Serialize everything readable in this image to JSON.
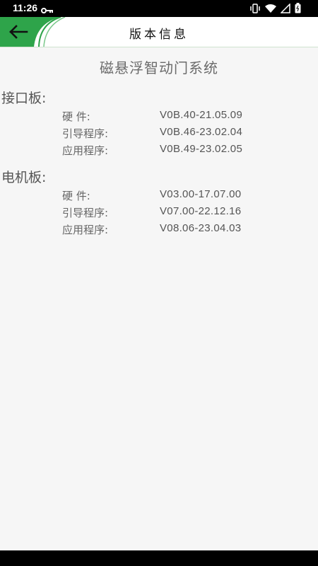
{
  "status_bar": {
    "time": "11:26"
  },
  "header": {
    "title": "版本信息"
  },
  "system": {
    "name": "磁悬浮智动门系统"
  },
  "sections": [
    {
      "title": "接口板:",
      "rows": [
        {
          "label": "硬 件:",
          "value": "V0B.40-21.05.09"
        },
        {
          "label": "引导程序:",
          "value": "V0B.46-23.02.04"
        },
        {
          "label": "应用程序:",
          "value": "V0B.49-23.02.05"
        }
      ]
    },
    {
      "title": "电机板:",
      "rows": [
        {
          "label": "硬 件:",
          "value": "V03.00-17.07.00"
        },
        {
          "label": "引导程序:",
          "value": "V07.00-22.12.16"
        },
        {
          "label": "应用程序:",
          "value": "V08.06-23.04.03"
        }
      ]
    }
  ],
  "colors": {
    "accent": "#2ea44a",
    "background": "#f6f6f6"
  }
}
